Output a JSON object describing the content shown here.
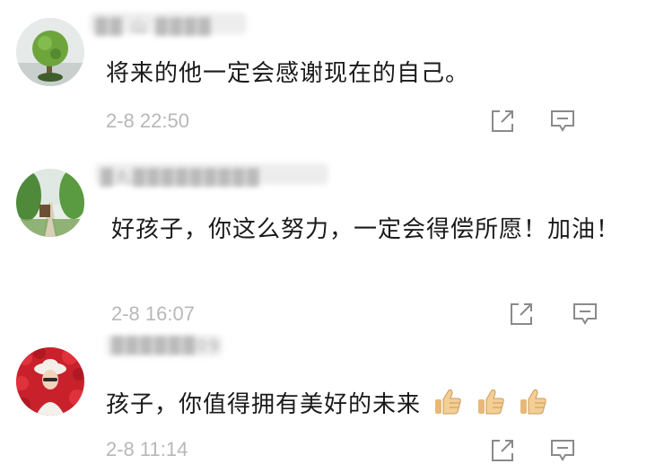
{
  "comments": [
    {
      "username": "▓▓ 山 ▓▓▓▓",
      "text": "将来的他一定会感谢现在的自己。",
      "time": "2-8 22:50",
      "icons": {
        "avatar": "moss-ball-tree-avatar",
        "share": "share-icon",
        "reply": "reply-icon"
      }
    },
    {
      "username": "▓丸▓▓▓▓▓▓▓▓▓",
      "text": "好孩子，你这么努力，一定会得偿所愿！加油！",
      "time": "2-8 16:07",
      "icons": {
        "avatar": "garden-path-avatar",
        "share": "share-icon",
        "reply": "reply-icon"
      }
    },
    {
      "username": "▓▓▓▓▓▓09",
      "text": "孩子，你值得拥有美好的未来",
      "time": "2-8 11:14",
      "emoji": [
        "thumbs-up",
        "thumbs-up",
        "thumbs-up"
      ],
      "icons": {
        "avatar": "woman-with-red-roses-avatar",
        "share": "share-icon",
        "reply": "reply-icon"
      }
    }
  ],
  "colors": {
    "text": "#1a1a1a",
    "timestamp": "#b8b8b8",
    "icon": "#8a8a8a"
  }
}
